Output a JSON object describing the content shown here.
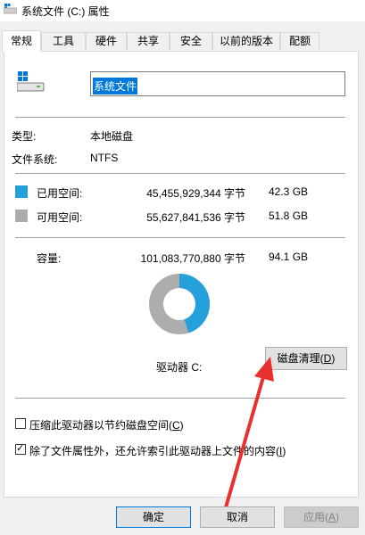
{
  "window": {
    "title": "系统文件 (C:) 属性"
  },
  "tabs": [
    {
      "label": "常规",
      "key": ""
    },
    {
      "label": "工具",
      "key": ""
    },
    {
      "label": "硬件",
      "key": ""
    },
    {
      "label": "共享",
      "key": ""
    },
    {
      "label": "安全",
      "key": ""
    },
    {
      "label": "以前的版本",
      "key": ""
    },
    {
      "label": "配额",
      "key": ""
    }
  ],
  "general": {
    "drive_name": "系统文件",
    "type_label": "类型:",
    "type_value": "本地磁盘",
    "fs_label": "文件系统:",
    "fs_value": "NTFS",
    "used_label": "已用空间:",
    "used_bytes": "45,455,929,344 字节",
    "used_gb": "42.3 GB",
    "free_label": "可用空间:",
    "free_bytes": "55,627,841,536 字节",
    "free_gb": "51.8 GB",
    "capacity_label": "容量:",
    "capacity_bytes": "101,083,770,880 字节",
    "capacity_gb": "94.1 GB",
    "drive_label": "驱动器 C:",
    "cleanup_label": "磁盘清理(",
    "cleanup_key": "D",
    "cleanup_end": ")",
    "used_fraction": 0.45,
    "colors": {
      "used": "#26a0da",
      "free": "#adadad",
      "arrow": "#e8312f"
    }
  },
  "options": {
    "compress_label": "压缩此驱动器以节约磁盘空间(",
    "compress_key": "C",
    "compress_end": ")",
    "compress_checked": false,
    "index_label": "除了文件属性外，还允许索引此驱动器上文件的内容(",
    "index_key": "I",
    "index_end": ")",
    "index_checked": true
  },
  "buttons": {
    "ok": "确定",
    "cancel": "取消",
    "apply_label": "应用(",
    "apply_key": "A",
    "apply_end": ")"
  }
}
